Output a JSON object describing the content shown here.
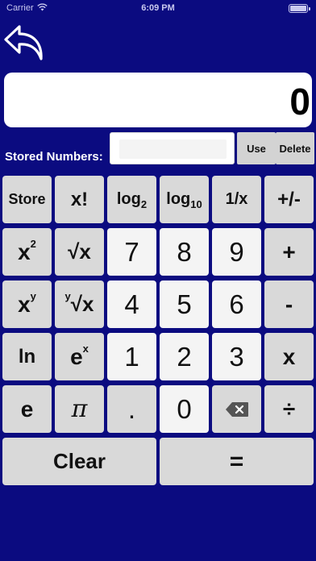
{
  "status_bar": {
    "carrier": "Carrier",
    "time": "6:09 PM"
  },
  "display": {
    "value": "0"
  },
  "stored": {
    "label": "Stored Numbers:",
    "value": "",
    "use_label": "Use",
    "delete_label": "Delete"
  },
  "keys": {
    "store": "Store",
    "factorial": "x!",
    "log2_base": "log",
    "log2_sub": "2",
    "log10_base": "log",
    "log10_sub": "10",
    "reciprocal": "1/x",
    "negate": "+/-",
    "square_base": "x",
    "square_sup": "2",
    "sqrt": "√x",
    "seven": "7",
    "eight": "8",
    "nine": "9",
    "plus": "+",
    "power_base": "x",
    "power_sup": "y",
    "yroot_pre": "y",
    "yroot": "√x",
    "four": "4",
    "five": "5",
    "six": "6",
    "minus": "-",
    "ln": "ln",
    "exp_base": "e",
    "exp_sup": "x",
    "one": "1",
    "two": "2",
    "three": "3",
    "multiply": "x",
    "euler": "e",
    "pi": "π",
    "decimal": ".",
    "zero": "0",
    "divide": "÷",
    "clear": "Clear",
    "equals": "="
  },
  "colors": {
    "background": "#0b0b80",
    "key_light": "#d9d9d9",
    "key_white": "#f4f4f4"
  },
  "icons": {
    "back": "back-arrow-icon",
    "backspace": "backspace-icon",
    "wifi": "wifi-icon",
    "battery": "battery-icon"
  }
}
